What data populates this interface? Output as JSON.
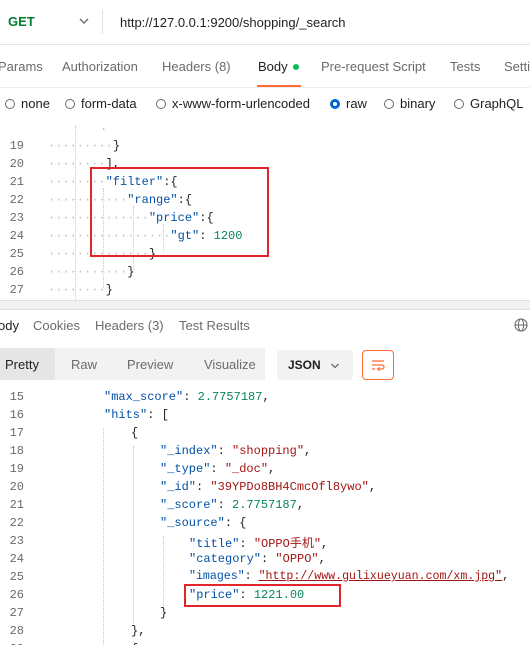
{
  "request": {
    "method": "GET",
    "url": "http://127.0.0.1:9200/shopping/_search"
  },
  "tabs": [
    "Params",
    "Authorization",
    "Headers (8)",
    "Body",
    "Pre-request Script",
    "Tests",
    "Setti"
  ],
  "body_modes": [
    "none",
    "form-data",
    "x-www-form-urlencoded",
    "raw",
    "binary",
    "GraphQL"
  ],
  "body_mode_selected": "raw",
  "request_lines": [
    {
      "n": "19",
      "t": "}"
    },
    {
      "n": "20",
      "t": "],"
    },
    {
      "n": "21",
      "k": "\"filter\"",
      "t": ":{"
    },
    {
      "n": "22",
      "k": "\"range\"",
      "t": ":{"
    },
    {
      "n": "23",
      "k": "\"price\"",
      "t": ":{"
    },
    {
      "n": "24",
      "k": "\"gt\"",
      "t": ": ",
      "v": "1200"
    },
    {
      "n": "25",
      "t": "}"
    },
    {
      "n": "26",
      "t": "}"
    },
    {
      "n": "27",
      "t": "}"
    }
  ],
  "response_tabs": [
    "ody",
    "Cookies",
    "Headers (3)",
    "Test Results"
  ],
  "view_modes": [
    "Pretty",
    "Raw",
    "Preview",
    "Visualize"
  ],
  "format": "JSON",
  "response_lines": [
    {
      "n": "15",
      "k": "\"max_score\"",
      "t": ": ",
      "v": "2.7757187",
      "e": ","
    },
    {
      "n": "16",
      "k": "\"hits\"",
      "t": ": ["
    },
    {
      "n": "17",
      "t": "{"
    },
    {
      "n": "18",
      "k": "\"_index\"",
      "t": ": ",
      "s": "\"shopping\"",
      "e": ","
    },
    {
      "n": "19",
      "k": "\"_type\"",
      "t": ": ",
      "s": "\"_doc\"",
      "e": ","
    },
    {
      "n": "20",
      "k": "\"_id\"",
      "t": ": ",
      "s": "\"39YPDo8BH4CmcOfl8ywo\"",
      "e": ","
    },
    {
      "n": "21",
      "k": "\"_score\"",
      "t": ": ",
      "v": "2.7757187",
      "e": ","
    },
    {
      "n": "22",
      "k": "\"_source\"",
      "t": ": {"
    },
    {
      "n": "23",
      "k": "\"title\"",
      "t": ": ",
      "s": "\"OPPO手机\"",
      "e": ","
    },
    {
      "n": "24",
      "k": "\"category\"",
      "t": ": ",
      "s": "\"OPPO\"",
      "e": ","
    },
    {
      "n": "25",
      "k": "\"images\"",
      "t": ": ",
      "s": "\"http://www.gulixueyuan.com/xm.jpg\"",
      "e": ","
    },
    {
      "n": "26",
      "k": "\"price\"",
      "t": ": ",
      "v": "1221.00"
    },
    {
      "n": "27",
      "t": "}"
    },
    {
      "n": "28",
      "t": "},"
    },
    {
      "n": "29",
      "t": "{"
    }
  ],
  "colors": {
    "accent": "#ff6c37",
    "method_get": "#007f31",
    "highlight_box": "#e0262b",
    "radio_selected": "#0265d2",
    "json_key": "#0451a5",
    "json_string": "#a31515",
    "json_number": "#098658"
  }
}
